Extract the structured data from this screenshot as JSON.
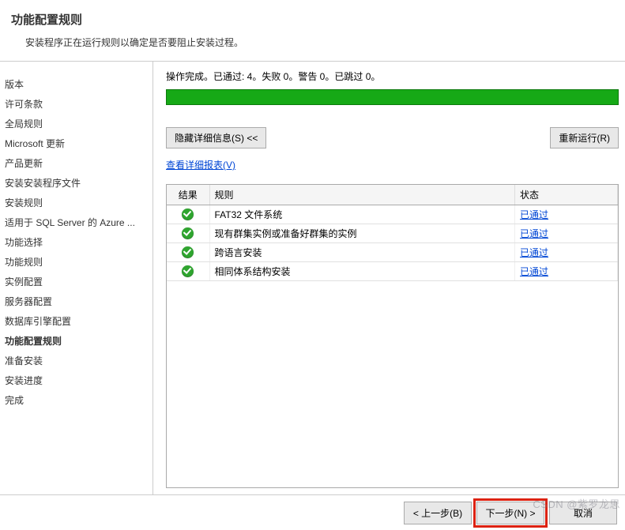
{
  "header": {
    "title": "功能配置规则",
    "subtitle": "安装程序正在运行规则以确定是否要阻止安装过程。"
  },
  "sidebar": {
    "items": [
      {
        "label": "版本"
      },
      {
        "label": "许可条款"
      },
      {
        "label": "全局规则"
      },
      {
        "label": "Microsoft 更新"
      },
      {
        "label": "产品更新"
      },
      {
        "label": "安装安装程序文件"
      },
      {
        "label": "安装规则"
      },
      {
        "label": "适用于 SQL Server 的 Azure ..."
      },
      {
        "label": "功能选择"
      },
      {
        "label": "功能规则"
      },
      {
        "label": "实例配置"
      },
      {
        "label": "服务器配置"
      },
      {
        "label": "数据库引擎配置"
      },
      {
        "label": "功能配置规则",
        "active": true
      },
      {
        "label": "准备安装"
      },
      {
        "label": "安装进度"
      },
      {
        "label": "完成"
      }
    ]
  },
  "main": {
    "status_text": "操作完成。已通过: 4。失败 0。警告 0。已跳过 0。",
    "hide_details_btn": "隐藏详细信息(S) <<",
    "rerun_btn": "重新运行(R)",
    "view_report_link": "查看详细报表(V)",
    "table": {
      "columns": {
        "result": "结果",
        "rule": "规则",
        "status": "状态"
      },
      "rows": [
        {
          "rule": "FAT32 文件系统",
          "status": "已通过"
        },
        {
          "rule": "现有群集实例或准备好群集的实例",
          "status": "已通过"
        },
        {
          "rule": "跨语言安装",
          "status": "已通过"
        },
        {
          "rule": "相同体系结构安装",
          "status": "已通过"
        }
      ]
    }
  },
  "footer": {
    "back": "< 上一步(B)",
    "next": "下一步(N) >",
    "cancel": "取消"
  },
  "watermark": "CSDN @紫罗龙思"
}
